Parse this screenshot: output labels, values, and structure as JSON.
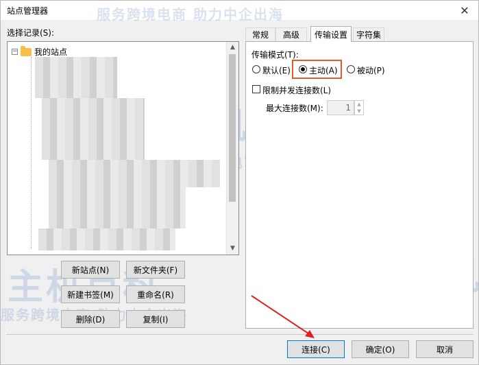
{
  "window": {
    "title": "站点管理器",
    "close_glyph": "✕"
  },
  "watermark": {
    "brand": "主机百科",
    "slogan": "服务跨境电商 助力中企出海"
  },
  "site_list": {
    "label": "选择记录(S):",
    "root_label": "我的站点"
  },
  "left_buttons": {
    "new_site": "新站点(N)",
    "new_folder": "新文件夹(F)",
    "new_bookmark": "新建书签(M)",
    "rename": "重命名(R)",
    "delete": "删除(D)",
    "copy": "复制(I)"
  },
  "tabs": [
    {
      "label": "常规",
      "active": false
    },
    {
      "label": "高级",
      "active": false
    },
    {
      "label": "传输设置",
      "active": true
    },
    {
      "label": "字符集",
      "active": false
    }
  ],
  "transfer_settings": {
    "mode_label": "传输模式(T):",
    "modes": [
      {
        "label": "默认(E)",
        "selected": false
      },
      {
        "label": "主动(A)",
        "selected": true
      },
      {
        "label": "被动(P)",
        "selected": false
      }
    ],
    "limit_label": "限制并发连接数(L)",
    "limit_checked": false,
    "max_conn_label": "最大连接数(M):",
    "max_conn_value": "1"
  },
  "bottom_buttons": {
    "connect": "连接(C)",
    "ok": "确定(O)",
    "cancel": "取消"
  },
  "colors": {
    "highlight": "#e25b2b",
    "annotation_arrow": "#e02020",
    "focus": "#0078d7"
  }
}
